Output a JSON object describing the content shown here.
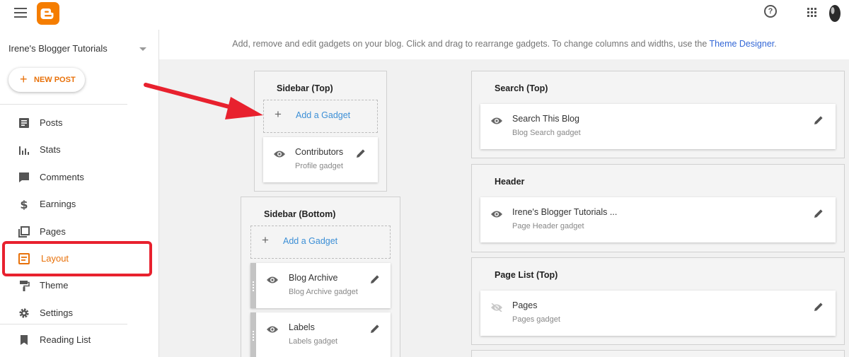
{
  "topbar": {
    "menu_icon": "hamburger-menu-icon",
    "logo_icon": "blogger-logo-icon",
    "help_icon": "help-circle-icon",
    "apps_icon": "apps-grid-icon",
    "help_glyph": "?"
  },
  "sidebar": {
    "blog_name": "Irene's Blogger Tutorials",
    "new_post_plus": "+",
    "new_post_label": "NEW POST",
    "items": [
      {
        "label": "Posts",
        "icon": "posts-icon"
      },
      {
        "label": "Stats",
        "icon": "stats-icon"
      },
      {
        "label": "Comments",
        "icon": "comments-icon"
      },
      {
        "label": "Earnings",
        "icon": "dollar-icon"
      },
      {
        "label": "Pages",
        "icon": "pages-icon"
      },
      {
        "label": "Layout",
        "icon": "layout-icon"
      },
      {
        "label": "Theme",
        "icon": "paint-roller-icon"
      },
      {
        "label": "Settings",
        "icon": "gear-icon"
      },
      {
        "label": "Reading List",
        "icon": "bookmark-icon"
      }
    ],
    "active_item": "Layout"
  },
  "main": {
    "info_text": "Add, remove and edit gadgets on your blog. Click and drag to rearrange gadgets. To change columns and widths, use the ",
    "info_link": "Theme Designer",
    "info_end": ".",
    "add_gadget_plus": "+",
    "sections": {
      "sidebar_top": {
        "title": "Sidebar (Top)",
        "add_label": "Add a Gadget",
        "gadgets": [
          {
            "name": "Contributors",
            "type": "Profile gadget"
          }
        ]
      },
      "sidebar_bottom": {
        "title": "Sidebar (Bottom)",
        "add_label": "Add a Gadget",
        "gadgets": [
          {
            "name": "Blog Archive",
            "type": "Blog Archive gadget"
          },
          {
            "name": "Labels",
            "type": "Labels gadget"
          }
        ]
      },
      "search_top": {
        "title": "Search (Top)",
        "gadgets": [
          {
            "name": "Search This Blog",
            "type": "Blog Search gadget"
          }
        ]
      },
      "header": {
        "title": "Header",
        "gadgets": [
          {
            "name": "Irene's Blogger Tutorials ...",
            "type": "Page Header gadget"
          }
        ]
      },
      "page_list_top": {
        "title": "Page List (Top)",
        "gadgets": [
          {
            "name": "Pages",
            "type": "Pages gadget",
            "hidden": true
          }
        ]
      }
    }
  },
  "colors": {
    "accent_orange": "#e8710a",
    "link_blue": "#3c8fd6",
    "annotation_red": "#e8212e"
  }
}
